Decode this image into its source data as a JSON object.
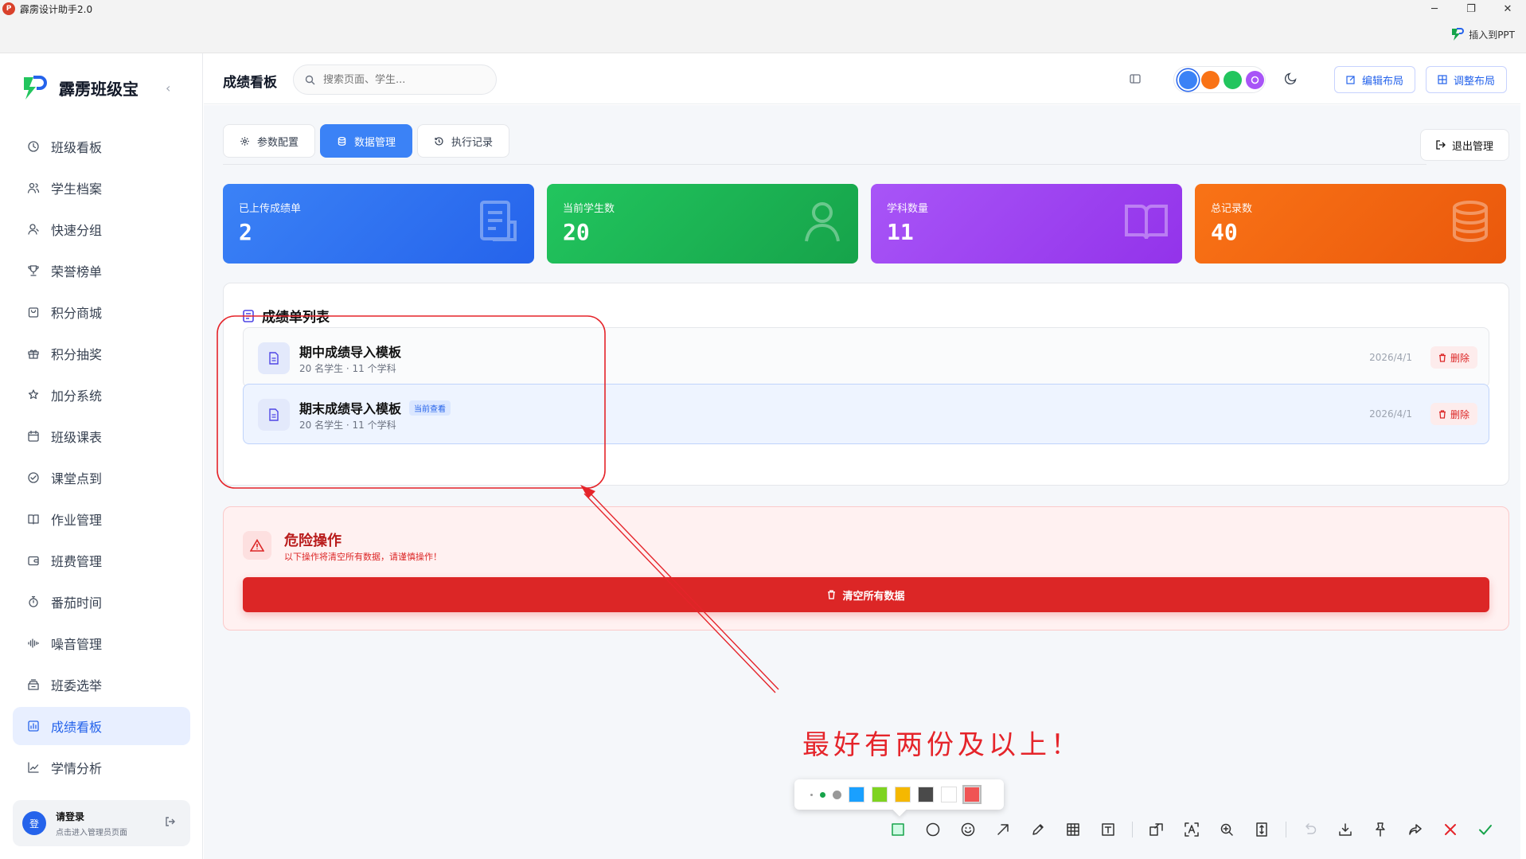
{
  "window": {
    "title": "霹雳设计助手2.0",
    "minimize": "─",
    "maximize": "❐",
    "close": "✕",
    "insert_ppt": "插入到PPT"
  },
  "brand": {
    "name": "霹雳班级宝",
    "collapse_icon": "‹"
  },
  "sidebar": {
    "items": [
      {
        "label": "班级看板",
        "icon": "clock-icon"
      },
      {
        "label": "学生档案",
        "icon": "users-icon"
      },
      {
        "label": "快速分组",
        "icon": "user-group-icon"
      },
      {
        "label": "荣誉榜单",
        "icon": "trophy-icon"
      },
      {
        "label": "积分商城",
        "icon": "shop-icon"
      },
      {
        "label": "积分抽奖",
        "icon": "gift-icon"
      },
      {
        "label": "加分系统",
        "icon": "plus-star-icon"
      },
      {
        "label": "班级课表",
        "icon": "calendar-icon"
      },
      {
        "label": "课堂点到",
        "icon": "check-circle-icon"
      },
      {
        "label": "作业管理",
        "icon": "book-icon"
      },
      {
        "label": "班费管理",
        "icon": "wallet-icon"
      },
      {
        "label": "番茄时间",
        "icon": "timer-icon"
      },
      {
        "label": "噪音管理",
        "icon": "sound-wave-icon"
      },
      {
        "label": "班委选举",
        "icon": "ballot-icon"
      },
      {
        "label": "成绩看板",
        "icon": "bar-chart-icon",
        "active": true
      },
      {
        "label": "学情分析",
        "icon": "line-chart-icon"
      }
    ],
    "login": {
      "avatar_text": "登",
      "title": "请登录",
      "subtitle": "点击进入管理员页面"
    }
  },
  "header": {
    "title": "成绩看板",
    "search_placeholder": "搜索页面、学生...",
    "theme_colors": [
      "#3b82f6",
      "#f97316",
      "#22c55e",
      "#a855f7"
    ],
    "edit_layout": "编辑布局",
    "adjust_layout": "调整布局"
  },
  "tabs": [
    {
      "label": "参数配置",
      "icon": "gear-icon"
    },
    {
      "label": "数据管理",
      "icon": "database-icon",
      "active": true
    },
    {
      "label": "执行记录",
      "icon": "history-icon"
    }
  ],
  "exit_label": "退出管理",
  "stats": [
    {
      "label": "已上传成绩单",
      "value": "2",
      "color": "#2563eb",
      "icon": "document-icon"
    },
    {
      "label": "当前学生数",
      "value": "20",
      "color": "#16a34a",
      "icon": "user-icon"
    },
    {
      "label": "学科数量",
      "value": "11",
      "color": "#9333ea",
      "icon": "open-book-icon"
    },
    {
      "label": "总记录数",
      "value": "40",
      "color": "#ea580c",
      "icon": "database-icon"
    }
  ],
  "list": {
    "title": "成绩单列表",
    "rows": [
      {
        "name": "期中成绩导入模板",
        "meta": "20 名学生 · 11 个学科",
        "date": "2026/4/1",
        "delete": "删除",
        "badge": ""
      },
      {
        "name": "期末成绩导入模板",
        "meta": "20 名学生 · 11 个学科",
        "date": "2026/4/1",
        "delete": "删除",
        "badge": "当前查看"
      }
    ]
  },
  "danger": {
    "title": "危险操作",
    "subtitle": "以下操作将清空所有数据，请谨慎操作！",
    "button": "清空所有数据"
  },
  "annotation": {
    "text": "最好有两份及以上！",
    "color": "#e5242a"
  },
  "palette": {
    "colors": [
      "#1aa0ff",
      "#7ed321",
      "#f5b800",
      "#4a4a4a",
      "#ffffff",
      "#f05454"
    ]
  },
  "toolbar": [
    "rectangle-icon",
    "ellipse-icon",
    "emoji-icon",
    "arrow-icon",
    "pen-icon",
    "mosaic-icon",
    "text-icon",
    "pin-image-icon",
    "ocr-icon",
    "magnifier-icon",
    "scroll-capture-icon",
    "undo-icon",
    "save-icon",
    "pin-icon",
    "share-icon",
    "cancel-icon",
    "confirm-icon"
  ]
}
